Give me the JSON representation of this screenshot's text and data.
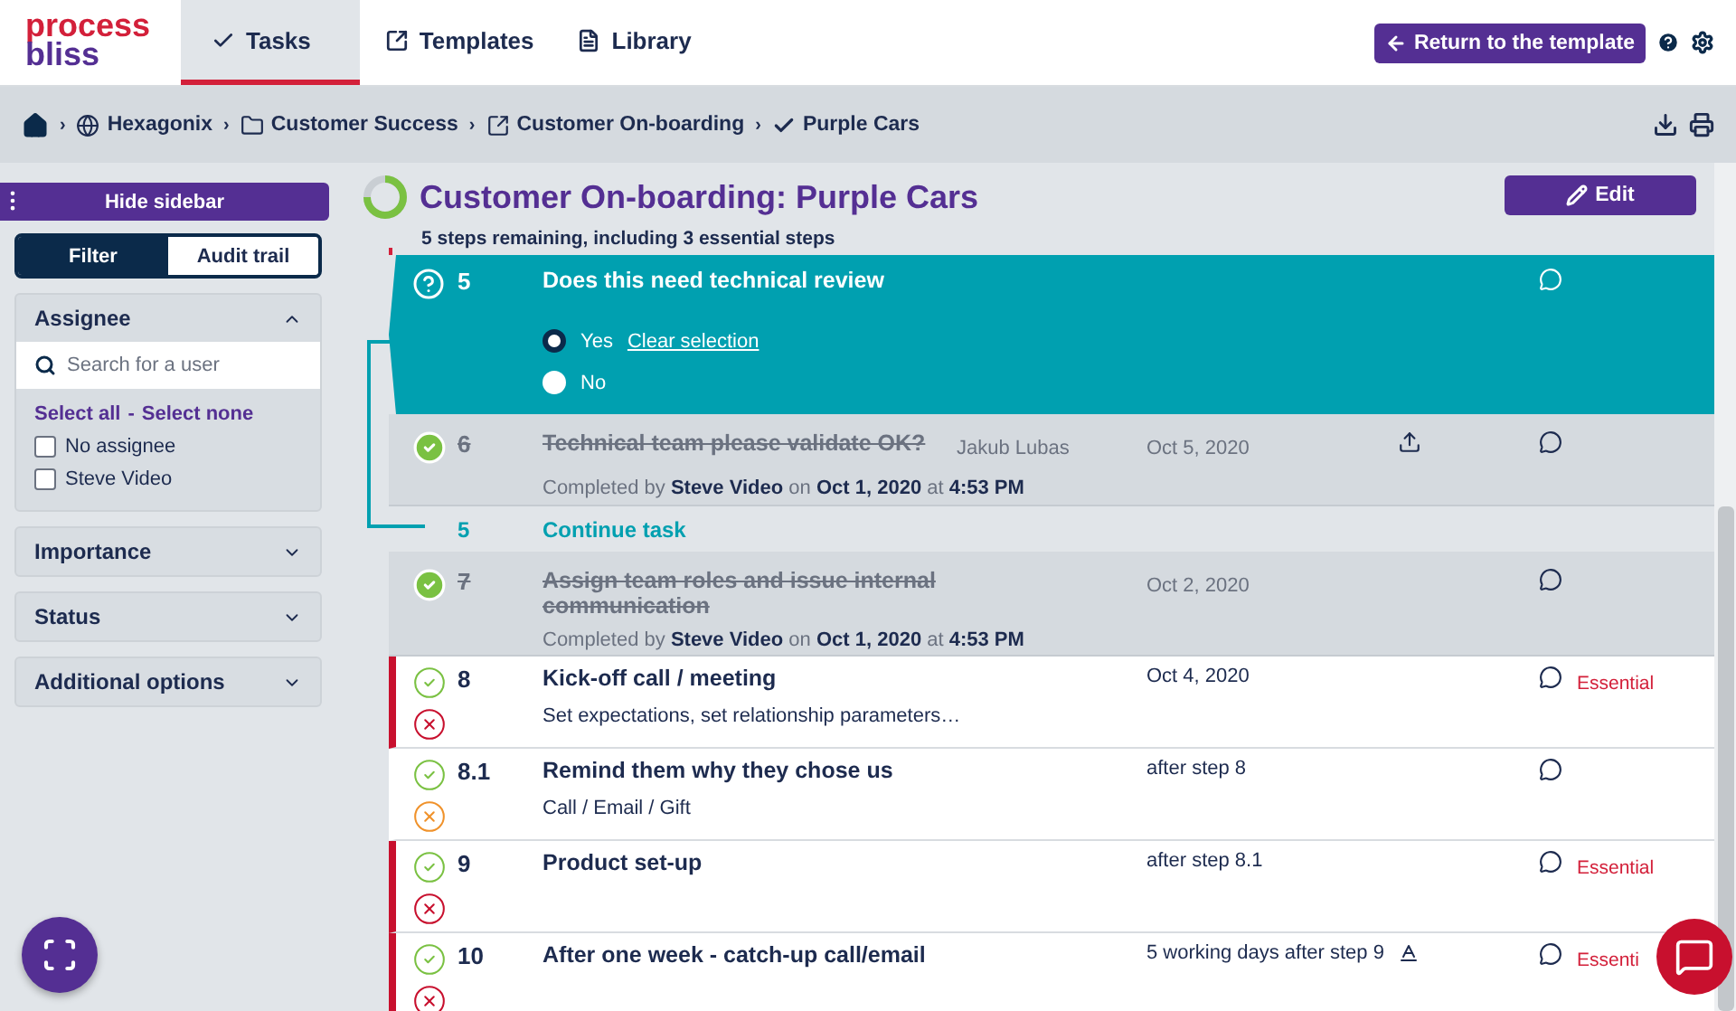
{
  "header": {
    "logo": {
      "line1": "process",
      "line2": "bliss"
    },
    "nav": [
      {
        "kind": "tasks",
        "label": "Tasks",
        "selected": true
      },
      {
        "kind": "templates",
        "label": "Templates",
        "selected": false
      },
      {
        "kind": "library",
        "label": "Library",
        "selected": false
      }
    ],
    "return_button": "Return to the template"
  },
  "breadcrumb_separator": "›",
  "breadcrumb": [
    {
      "kind": "home"
    },
    {
      "kind": "globe",
      "label": "Hexagonix"
    },
    {
      "kind": "folder",
      "label": "Customer Success"
    },
    {
      "kind": "template",
      "label": "Customer On-boarding"
    },
    {
      "kind": "check",
      "label": "Purple Cars"
    }
  ],
  "sidebar": {
    "hide_button": "Hide sidebar",
    "tabs": [
      {
        "label": "Filter",
        "selected": true
      },
      {
        "label": "Audit trail",
        "selected": false
      }
    ],
    "sections": [
      {
        "title": "Assignee",
        "expanded": true,
        "search": {
          "placeholder": "Search for a user"
        },
        "select_all": "Select all",
        "separator": "-",
        "select_none": "Select none",
        "options": [
          {
            "label": "No assignee",
            "checked": false
          },
          {
            "label": "Steve Video",
            "checked": false
          }
        ]
      },
      {
        "title": "Importance",
        "expanded": false
      },
      {
        "title": "Status",
        "expanded": false
      },
      {
        "title": "Additional options",
        "expanded": false
      }
    ]
  },
  "checklist": {
    "title": "Customer On-boarding: Purple Cars",
    "progress": {
      "level": 0.75
    },
    "subtitle": "5 steps remaining, including 3 essential steps",
    "edit_button": "Edit",
    "steps": [
      {
        "kind": "question",
        "number": "5",
        "title": "Does this need technical review",
        "answers": [
          {
            "label": "Yes",
            "selected": true
          },
          {
            "label": "No",
            "selected": false
          }
        ],
        "clear_link": "Clear selection"
      },
      {
        "kind": "done",
        "number": "6",
        "title": "Technical team please validate OK?",
        "assignee": "Jakub Lubas",
        "date": "Oct 5, 2020",
        "upload": true,
        "completed": "Completed by **Steve Video** on **Oct 1, 2020** at **4:53 PM**"
      },
      {
        "kind": "continue",
        "number": "5",
        "title": "Continue task"
      },
      {
        "kind": "done",
        "number": "7",
        "title": "Assign team roles and issue internal communication",
        "date": "Oct 2, 2020",
        "upload": false,
        "completed": "Completed by **Steve Video** on **Oct 1, 2020** at **4:53 PM**"
      },
      {
        "kind": "todo",
        "number": "8",
        "title": "Kick-off call / meeting",
        "date": "Oct 4, 2020",
        "essential": true,
        "tag": "Essential",
        "description": "Set expectations, set relationship parameters…",
        "date_flag": false
      },
      {
        "kind": "todo",
        "number": "8.1",
        "title": "Remind them why they chose us",
        "date": "after step 8",
        "essential": false,
        "description": "Call / Email / Gift",
        "date_flag": false
      },
      {
        "kind": "todo",
        "number": "9",
        "title": "Product set-up",
        "date": "after step 8.1",
        "essential": true,
        "tag": "Essential",
        "date_flag": false
      },
      {
        "kind": "todo",
        "number": "10",
        "title": "After one week - catch-up call/email",
        "date": "5 working days after step 9",
        "essential": true,
        "tag": "Essenti",
        "date_flag": true
      }
    ]
  }
}
